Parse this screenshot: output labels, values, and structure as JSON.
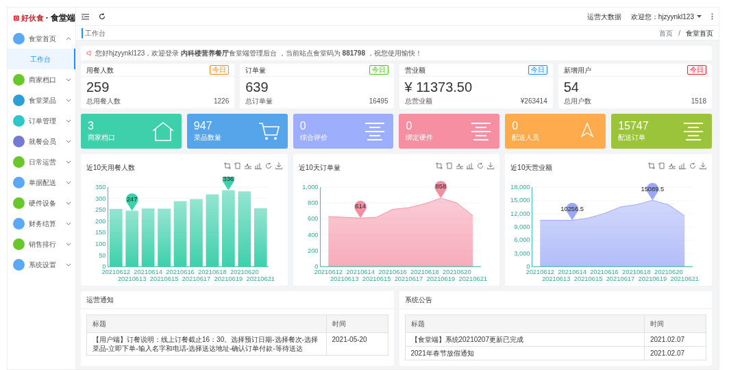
{
  "logo": {
    "brand": "好伙食",
    "suffix": "· 食堂端"
  },
  "topbar": {
    "link": "运营大数据",
    "user": "欢迎您：hjzyynkl123"
  },
  "page_title": "工作台",
  "breadcrumb": [
    "首页",
    "食堂首页"
  ],
  "breadcrumb_separator": "/",
  "sidebar": {
    "items": [
      {
        "label": "食堂首页",
        "color": "#5aa9f7",
        "expanded": true,
        "children": [
          {
            "label": "工作台",
            "selected": true
          }
        ]
      },
      {
        "label": "商家档口",
        "color": "#69c72b",
        "expanded": false
      },
      {
        "label": "食堂菜品",
        "color": "#2d9fd8",
        "expanded": false
      },
      {
        "label": "订单管理",
        "color": "#2ec7c9",
        "expanded": false
      },
      {
        "label": "就餐会员",
        "color": "#7479d4",
        "expanded": false
      },
      {
        "label": "日常运营",
        "color": "#69c72b",
        "expanded": false
      },
      {
        "label": "单据配送",
        "color": "#5aa9f7",
        "expanded": false
      },
      {
        "label": "硬件设备",
        "color": "#69c72b",
        "expanded": false
      },
      {
        "label": "财务结算",
        "color": "#5aa9f7",
        "expanded": false
      },
      {
        "label": "销售排行",
        "color": "#69c72b",
        "expanded": false
      },
      {
        "label": "系统设置",
        "color": "#5aa9f7",
        "expanded": false
      }
    ]
  },
  "notice": "您好hjzyynkl123，欢迎登录 **内科楼营养餐厅**食堂端管理后台 ，当前站点食堂码为 **881798** ，祝您使用愉快！",
  "stats": [
    {
      "title": "用餐人数",
      "tag": "今日",
      "color": "#fa8c16",
      "value": "259",
      "total_label": "总用餐人数",
      "total": "1226"
    },
    {
      "title": "订单量",
      "tag": "今日",
      "color": "#52c41a",
      "value": "639",
      "total_label": "总订单量",
      "total": "16495"
    },
    {
      "title": "营业额",
      "tag": "今日",
      "color": "#1890ff",
      "value": "¥ 11373.50",
      "total_label": "总营业额",
      "total": "¥263414"
    },
    {
      "title": "新增用户",
      "tag": "今日",
      "color": "#f5222d",
      "value": "54",
      "total_label": "总用户数",
      "total": "1518"
    }
  ],
  "tiles": [
    {
      "value": "3",
      "label": "商家档口",
      "color": "#3ed0ab",
      "kind": "house"
    },
    {
      "value": "947",
      "label": "菜品数量",
      "color": "#56a5ea",
      "kind": "cart"
    },
    {
      "value": "0",
      "label": "综合评价",
      "color": "#9daefc",
      "kind": "lines"
    },
    {
      "value": "0",
      "label": "绑定硬件",
      "color": "#f68fa2",
      "kind": "lines"
    },
    {
      "value": "0",
      "label": "配送人员",
      "color": "#fdab4d",
      "kind": "top"
    },
    {
      "value": "15747",
      "label": "配送订单",
      "color": "#9cc43a",
      "kind": "lines"
    }
  ],
  "charts": [
    {
      "chart_data": {
        "type": "bar",
        "title": "近10天用餐人数",
        "categories": [
          "20210612",
          "20210613",
          "20210614",
          "20210615",
          "20210616",
          "20210617",
          "20210618",
          "20210619",
          "20210620",
          "20210621"
        ],
        "series": [
          {
            "color": "#3ed0ab",
            "values": [
              254,
              246,
              256,
              255,
              288,
              297,
              318,
              336,
              331,
              257
            ]
          }
        ],
        "ylim": [
          0,
          350
        ],
        "yticks": [
          0,
          50,
          100,
          150,
          200,
          250,
          300,
          350
        ],
        "grid": true,
        "annotations": [
          {
            "x": "20210613",
            "y": 246,
            "text": "247"
          },
          {
            "x": "20210619",
            "y": 336,
            "text": "336"
          }
        ]
      }
    },
    {
      "chart_data": {
        "type": "area",
        "title": "近10天订单量",
        "categories": [
          "20210612",
          "20210613",
          "20210614",
          "20210615",
          "20210616",
          "20210617",
          "20210618",
          "20210619",
          "20210620",
          "20210621"
        ],
        "series": [
          {
            "color": "#f48fa3",
            "values": [
              630,
              620,
              610,
              620,
              720,
              740,
              790,
              860,
              800,
              640
            ]
          }
        ],
        "ylim": [
          0,
          1000
        ],
        "yticks": [
          {
            "value": 0,
            "label": "0"
          },
          {
            "value": 200,
            "label": "200"
          },
          {
            "value": 400,
            "label": "400"
          },
          {
            "value": 600,
            "label": "600"
          },
          {
            "value": 800,
            "label": "800"
          },
          {
            "value": 1000,
            "label": "1,000"
          }
        ],
        "grid": true,
        "annotations": [
          {
            "x": "20210614",
            "y": 610,
            "text": "614"
          },
          {
            "x": "20210619",
            "y": 860,
            "text": "858"
          }
        ]
      }
    },
    {
      "chart_data": {
        "type": "area",
        "title": "近10天营业额",
        "categories": [
          "20210612",
          "20210613",
          "20210614",
          "20210615",
          "20210616",
          "20210617",
          "20210618",
          "20210619",
          "20210620",
          "20210621"
        ],
        "series": [
          {
            "color": "#9aa8f7",
            "values": [
              10500,
              10500,
              10500,
              11000,
              12000,
              13500,
              14000,
              15000,
              14000,
              11500
            ]
          }
        ],
        "ylim": [
          0,
          18000
        ],
        "yticks": [
          {
            "value": 0,
            "label": "0"
          },
          {
            "value": 3000,
            "label": "3,000"
          },
          {
            "value": 6000,
            "label": "6,000"
          },
          {
            "value": 9000,
            "label": "9,000"
          },
          {
            "value": 12000,
            "label": "12,000"
          },
          {
            "value": 15000,
            "label": "15,000"
          },
          {
            "value": 18000,
            "label": "18,000"
          }
        ],
        "grid": true,
        "annotations": [
          {
            "x": "20210614",
            "y": 10500,
            "text": "10256.5"
          },
          {
            "x": "20210619",
            "y": 15000,
            "text": "15089.5"
          }
        ]
      }
    }
  ],
  "panels": [
    {
      "title": "运营通知",
      "columns": [
        "标题",
        "时间"
      ],
      "rows": [
        [
          "【用户端】订餐说明：线上订餐截止16：30。选择预订日期-选择餐次-选择菜品-立即下单-输入名字和电话-选择送达地址-确认订单付款-等待送达",
          "2021-05-20"
        ]
      ]
    },
    {
      "title": "系统公告",
      "columns": [
        "标题",
        "时间"
      ],
      "rows": [
        [
          "【食堂端】系统20210207更新已完成",
          "2021.02.07"
        ],
        [
          "2021年春节放假通知",
          "2021.02.07"
        ]
      ]
    }
  ]
}
